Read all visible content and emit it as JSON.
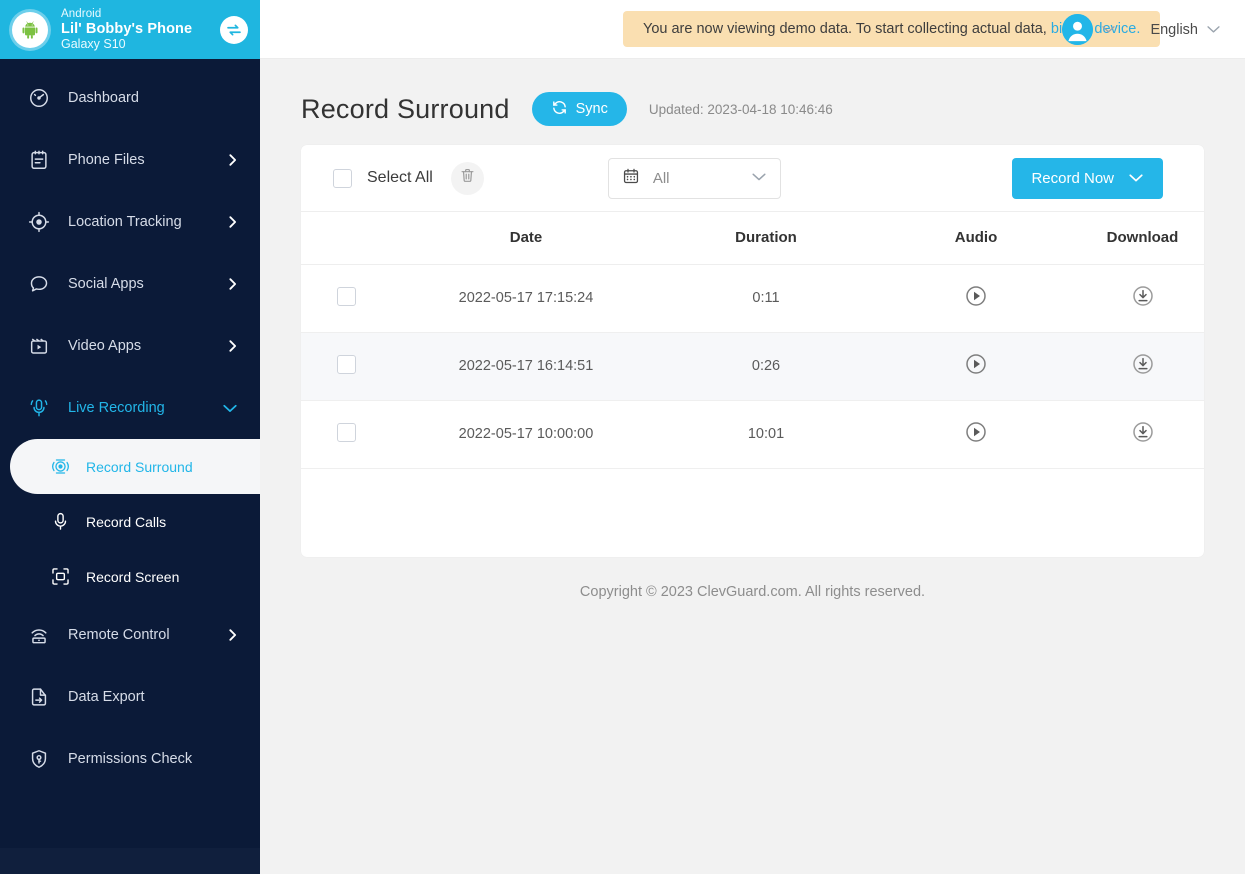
{
  "device": {
    "os": "Android",
    "name": "Lil' Bobby's Phone",
    "model": "Galaxy S10",
    "avatar_icon": "android-robot-icon",
    "switch_icon": "switch-device-icon"
  },
  "sidebar": {
    "items": [
      {
        "label": "Dashboard",
        "icon": "dashboard-gauge-icon",
        "has_chevron": false
      },
      {
        "label": "Phone Files",
        "icon": "clipboard-icon",
        "has_chevron": true
      },
      {
        "label": "Location Tracking",
        "icon": "location-target-icon",
        "has_chevron": true
      },
      {
        "label": "Social Apps",
        "icon": "chat-bubble-icon",
        "has_chevron": true
      },
      {
        "label": "Video Apps",
        "icon": "film-play-icon",
        "has_chevron": true
      },
      {
        "label": "Live Recording",
        "icon": "microphone-waves-icon",
        "has_chevron": true,
        "expanded": true,
        "active": true
      },
      {
        "label": "Remote Control",
        "icon": "remote-signal-icon",
        "has_chevron": true
      },
      {
        "label": "Data Export",
        "icon": "file-export-icon",
        "has_chevron": false
      },
      {
        "label": "Permissions Check",
        "icon": "shield-key-icon",
        "has_chevron": false
      }
    ],
    "sub_items": [
      {
        "label": "Record Surround",
        "icon": "record-surround-icon",
        "selected": true
      },
      {
        "label": "Record Calls",
        "icon": "microphone-icon",
        "selected": false
      },
      {
        "label": "Record Screen",
        "icon": "screen-capture-icon",
        "selected": false
      }
    ]
  },
  "topbar": {
    "banner_text": "You are now viewing demo data. To start collecting actual data,",
    "banner_link": "bind a device.",
    "language": "English",
    "user_icon": "user-avatar-icon"
  },
  "page": {
    "title": "Record Surround",
    "sync_label": "Sync",
    "sync_icon": "sync-refresh-icon",
    "updated": "Updated: 2023-04-18 10:46:46"
  },
  "toolbar": {
    "select_all_label": "Select All",
    "delete_icon": "trash-icon",
    "date_filter_value": "All",
    "date_filter_icon": "calendar-icon",
    "record_now_label": "Record Now"
  },
  "table": {
    "columns": [
      "",
      "Date",
      "Duration",
      "Audio",
      "Download"
    ],
    "rows": [
      {
        "date": "2022-05-17 17:15:24",
        "duration": "0:11",
        "audio_icon": "play-circle-icon",
        "download_icon": "download-circle-icon"
      },
      {
        "date": "2022-05-17 16:14:51",
        "duration": "0:26",
        "audio_icon": "play-circle-icon",
        "download_icon": "download-circle-icon"
      },
      {
        "date": "2022-05-17 10:00:00",
        "duration": "10:01",
        "audio_icon": "play-circle-icon",
        "download_icon": "download-circle-icon"
      }
    ]
  },
  "footer": {
    "copyright": "Copyright © 2023 ClevGuard.com. All rights reserved."
  },
  "colors": {
    "sidebar_bg": "#0b1a38",
    "device_header_bg": "#1fb6e0",
    "accent": "#25b6e8",
    "banner_bg": "#fadfb1",
    "page_bg": "#f2f2f2"
  }
}
